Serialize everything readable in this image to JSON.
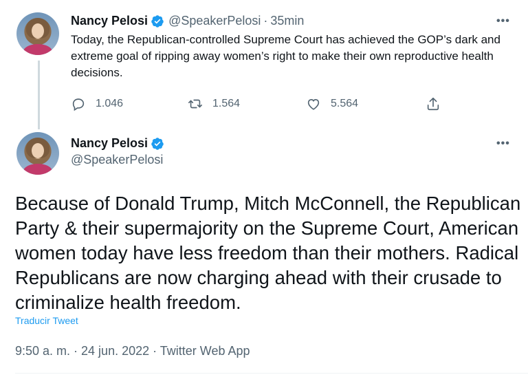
{
  "reply_tweet": {
    "author_name": "Nancy Pelosi",
    "handle": "@SpeakerPelosi",
    "separator": "·",
    "time": "35min",
    "more": "•••",
    "text": "Today, the Republican-controlled Supreme Court has achieved the GOP’s dark and extreme goal of ripping away women’s right to make their own reproductive health decisions.",
    "replies": "1.046",
    "retweets": "1.564",
    "likes": "5.564"
  },
  "main_tweet": {
    "author_name": "Nancy Pelosi",
    "handle": "@SpeakerPelosi",
    "more": "•••",
    "text": "Because of Donald Trump, Mitch McConnell, the Republican Party & their supermajority on the Supreme Court, American women today have less freedom than their mothers. Radical Republicans are now charging ahead with their crusade to criminalize health freedom.",
    "translate_label": "Traducir Tweet",
    "meta": "9:50 a. m. · 24 jun. 2022 · Twitter Web App"
  },
  "colors": {
    "accent": "#1d9bf0",
    "secondary_text": "#536471",
    "primary_text": "#0f1419"
  },
  "icons": [
    "verified-badge-icon",
    "reply-icon",
    "retweet-icon",
    "like-icon",
    "share-icon",
    "more-icon"
  ]
}
